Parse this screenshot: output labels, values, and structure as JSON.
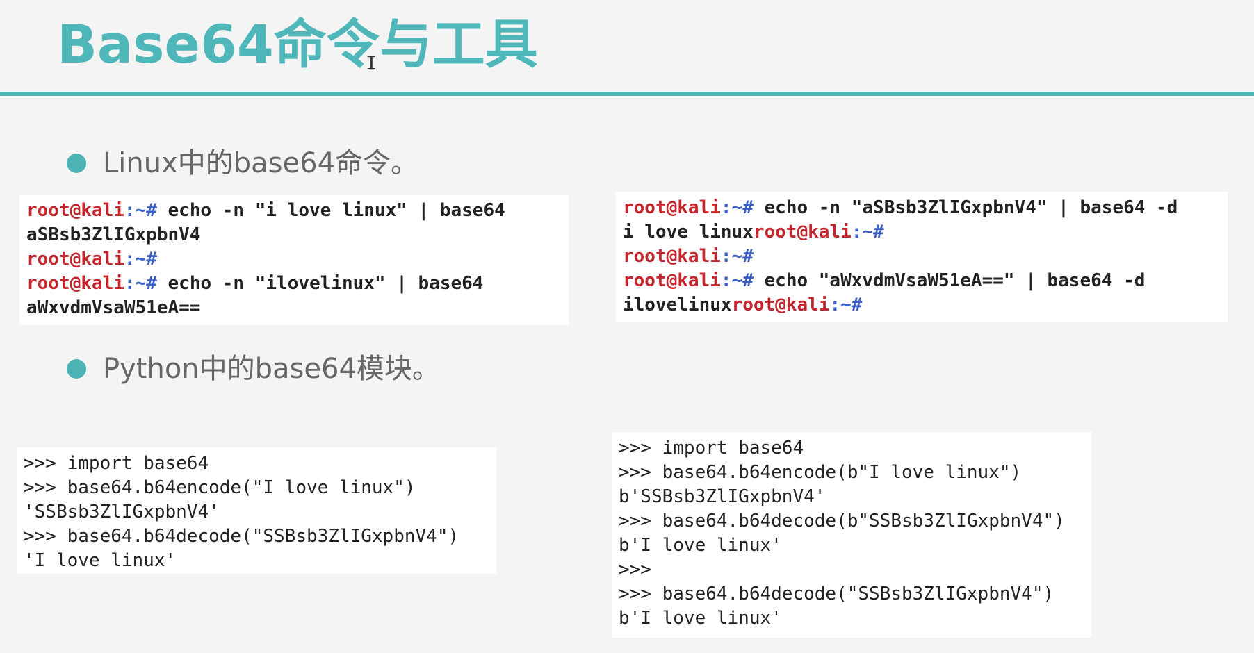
{
  "slide": {
    "title": "Base64命令与工具",
    "cursor_glyph": "I"
  },
  "bullets": {
    "linux": "Linux中的base64命令。",
    "python": "Python中的base64模块。"
  },
  "shell_prompt": {
    "user": "root@kali",
    "path": ":~#"
  },
  "linux_left": {
    "line1_cmd": " echo -n \"i love linux\" | base64",
    "line2_out": "aSBsb3ZlIGxpbnV4",
    "line4_cmd": " echo -n \"ilovelinux\" | base64",
    "line5_out": "aWxvdmVsaW51eA=="
  },
  "linux_right": {
    "line1_cmd": " echo -n \"aSBsb3ZlIGxpbnV4\" | base64 -d",
    "line2_out": "i love linux",
    "line4_cmd": " echo \"aWxvdmVsaW51eA==\" | base64 -d",
    "line5_out": "ilovelinux"
  },
  "python_left": [
    ">>> import base64",
    ">>> base64.b64encode(\"I love linux\")",
    "'SSBsb3ZlIGxpbnV4'",
    ">>> base64.b64decode(\"SSBsb3ZlIGxpbnV4\")",
    "'I love linux'"
  ],
  "python_right": [
    ">>> import base64",
    ">>> base64.b64encode(b\"I love linux\")",
    "b'SSBsb3ZlIGxpbnV4'",
    ">>> base64.b64decode(b\"SSBsb3ZlIGxpbnV4\")",
    "b'I love linux'",
    ">>>",
    ">>> base64.b64decode(\"SSBsb3ZlIGxpbnV4\")",
    "b'I love linux'"
  ],
  "colors": {
    "accent": "#4db3b5",
    "prompt_user": "#c4262e",
    "prompt_path": "#3a5ec4"
  }
}
